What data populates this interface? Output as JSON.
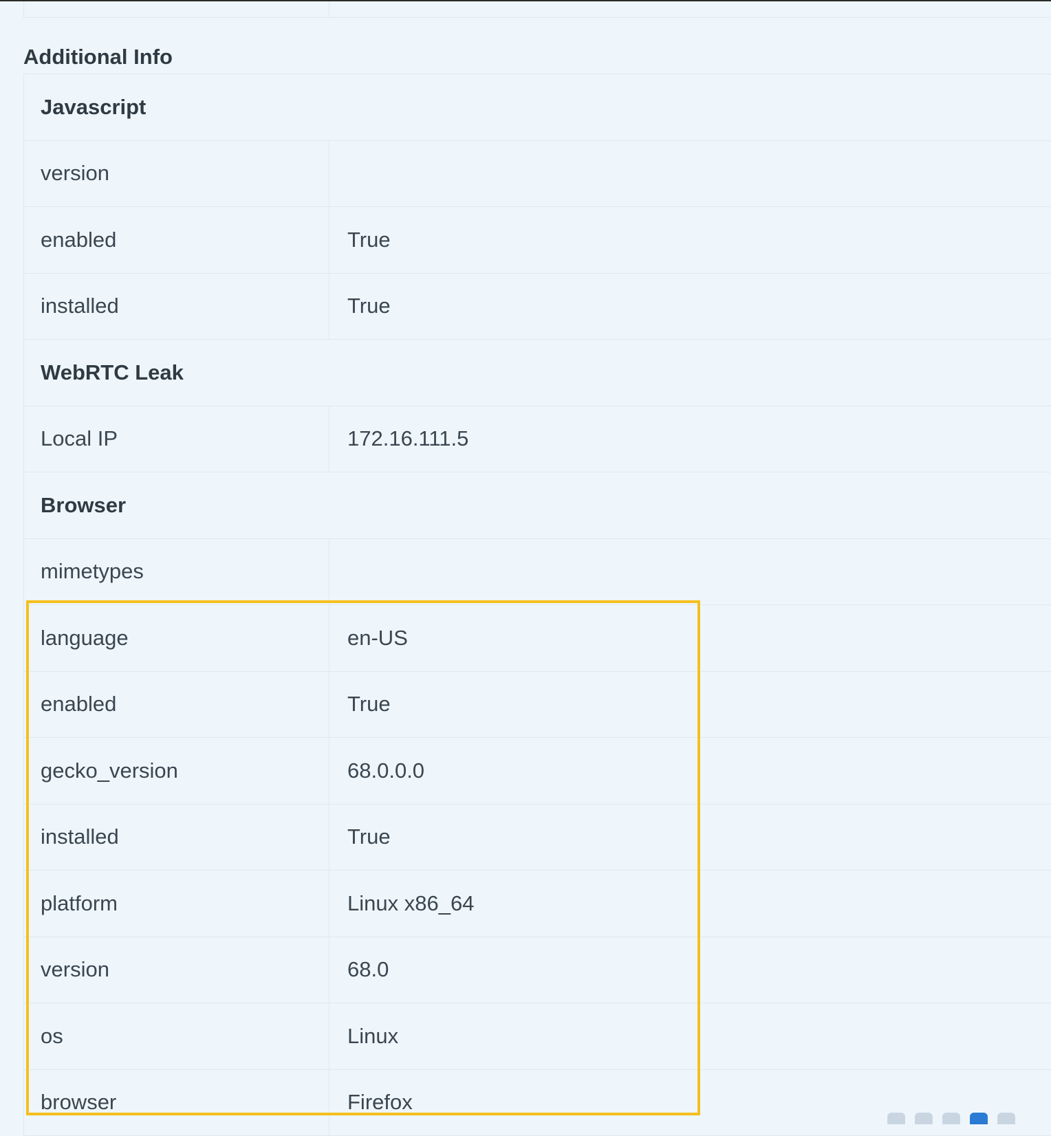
{
  "section_title": "Additional Info",
  "groups": [
    {
      "title": "Javascript",
      "rows": [
        {
          "key": "version",
          "value": ""
        },
        {
          "key": "enabled",
          "value": "True"
        },
        {
          "key": "installed",
          "value": "True"
        }
      ]
    },
    {
      "title": "WebRTC Leak",
      "rows": [
        {
          "key": "Local IP",
          "value": "172.16.111.5"
        }
      ]
    },
    {
      "title": "Browser",
      "rows": [
        {
          "key": "mimetypes",
          "value": ""
        },
        {
          "key": "language",
          "value": "en-US"
        },
        {
          "key": "enabled",
          "value": "True"
        },
        {
          "key": "gecko_version",
          "value": "68.0.0.0"
        },
        {
          "key": "installed",
          "value": "True"
        },
        {
          "key": "platform",
          "value": "Linux x86_64"
        },
        {
          "key": "version",
          "value": "68.0"
        },
        {
          "key": "os",
          "value": "Linux"
        },
        {
          "key": "browser",
          "value": "Firefox"
        }
      ]
    }
  ],
  "highlight_color": "#f5c01e",
  "tray_icons": [
    "network-icon",
    "disc-icon",
    "audio-icon",
    "display-icon",
    "usb-icon"
  ]
}
